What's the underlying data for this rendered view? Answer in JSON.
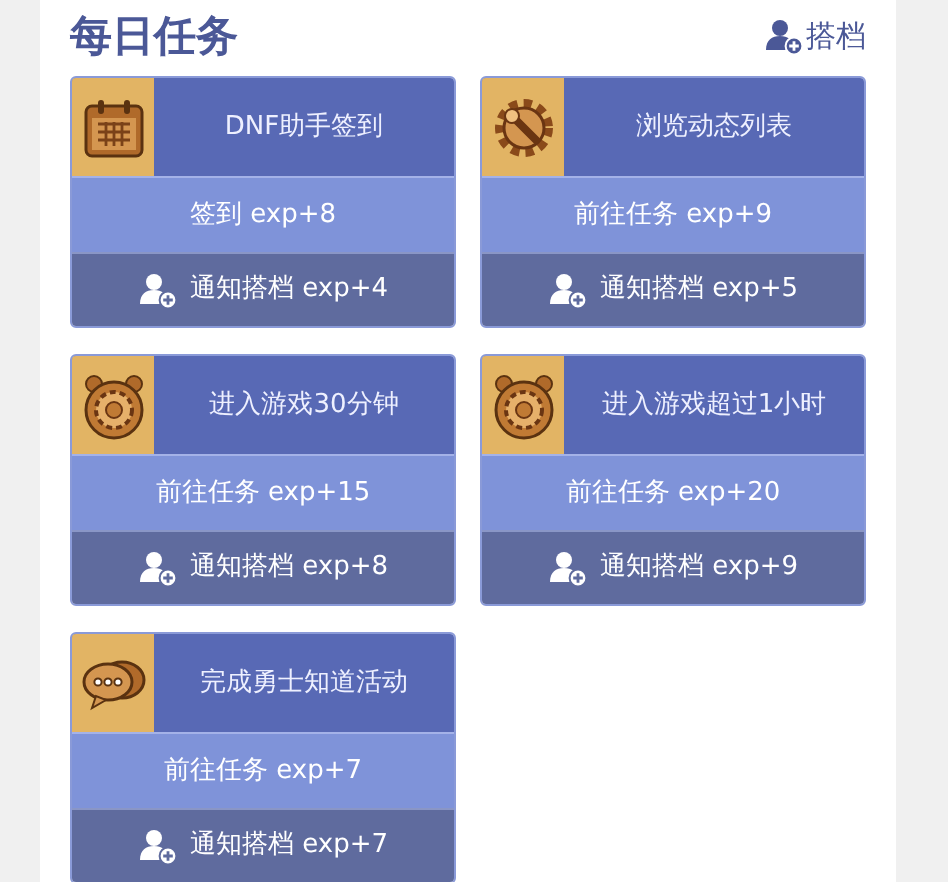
{
  "title": "每日任务",
  "partner_link": "搭档",
  "tasks": [
    {
      "kind": "calendar",
      "name": "DNF助手签到",
      "action": "签到 exp+8",
      "notify": "通知搭档 exp+4"
    },
    {
      "kind": "tool",
      "name": "浏览动态列表",
      "action": "前往任务 exp+9",
      "notify": "通知搭档 exp+5"
    },
    {
      "kind": "clock",
      "name": "进入游戏30分钟",
      "action": "前往任务 exp+15",
      "notify": "通知搭档 exp+8"
    },
    {
      "kind": "clock",
      "name": "进入游戏超过1小时",
      "action": "前往任务 exp+20",
      "notify": "通知搭档 exp+9"
    },
    {
      "kind": "chat",
      "name": "完成勇士知道活动",
      "action": "前往任务 exp+7",
      "notify": "通知搭档 exp+7"
    }
  ]
}
